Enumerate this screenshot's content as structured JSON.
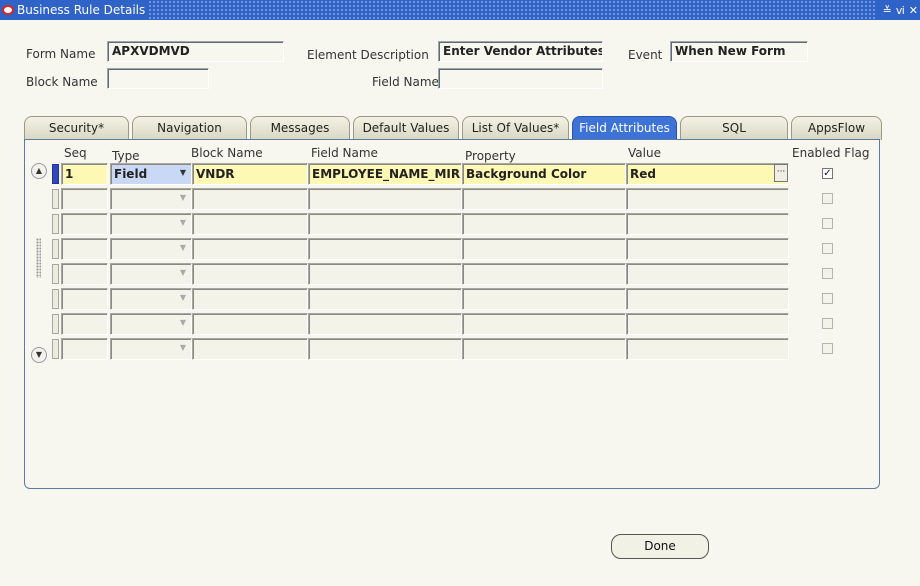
{
  "window": {
    "title": "Business Rule Details",
    "controls": [
      "≚",
      "ⅵ",
      "✕"
    ]
  },
  "header": {
    "form_name_label": "Form Name",
    "form_name_value": "APXVDMVD",
    "element_description_label": "Element Description",
    "element_description_value": "Enter Vendor Attributes",
    "event_label": "Event",
    "event_value": "When New Form",
    "block_name_label": "Block Name",
    "block_name_value": "",
    "field_name_label": "Field Name",
    "field_name_value": ""
  },
  "tabs": [
    {
      "label": "Security*",
      "active": false
    },
    {
      "label": "Navigation",
      "active": false
    },
    {
      "label": "Messages",
      "active": false
    },
    {
      "label": "Default Values",
      "active": false
    },
    {
      "label": "List Of Values*",
      "active": false
    },
    {
      "label": "Field Attributes",
      "active": true
    },
    {
      "label": "SQL",
      "active": false
    },
    {
      "label": "AppsFlow",
      "active": false
    }
  ],
  "grid": {
    "columns": [
      "Seq",
      "Type",
      "Block Name",
      "Field Name",
      "Property",
      "Value",
      "Enabled Flag"
    ],
    "rows": [
      {
        "seq": "1",
        "type": "Field",
        "block": "VNDR",
        "field": "EMPLOYEE_NAME_MIRROR",
        "property": "Background Color",
        "value": "Red",
        "enabled": true
      },
      {
        "seq": "",
        "type": "",
        "block": "",
        "field": "",
        "property": "",
        "value": "",
        "enabled": false
      },
      {
        "seq": "",
        "type": "",
        "block": "",
        "field": "",
        "property": "",
        "value": "",
        "enabled": false
      },
      {
        "seq": "",
        "type": "",
        "block": "",
        "field": "",
        "property": "",
        "value": "",
        "enabled": false
      },
      {
        "seq": "",
        "type": "",
        "block": "",
        "field": "",
        "property": "",
        "value": "",
        "enabled": false
      },
      {
        "seq": "",
        "type": "",
        "block": "",
        "field": "",
        "property": "",
        "value": "",
        "enabled": false
      },
      {
        "seq": "",
        "type": "",
        "block": "",
        "field": "",
        "property": "",
        "value": "",
        "enabled": false
      },
      {
        "seq": "",
        "type": "",
        "block": "",
        "field": "",
        "property": "",
        "value": "",
        "enabled": false
      }
    ]
  },
  "footer": {
    "done_label": "Done"
  }
}
